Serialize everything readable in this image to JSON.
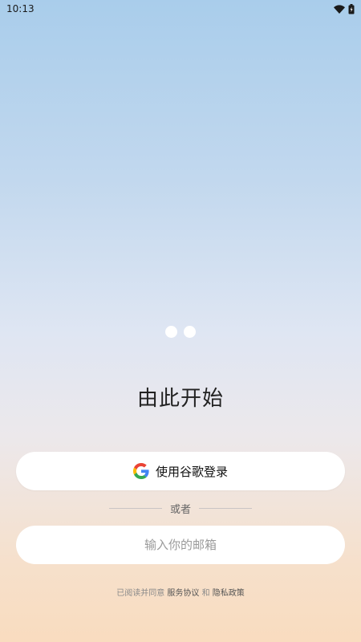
{
  "status_bar": {
    "time": "10:13"
  },
  "main": {
    "title": "由此开始",
    "google_button_label": "使用谷歌登录",
    "divider_text": "或者",
    "email_placeholder": "输入你的邮箱",
    "terms": {
      "prefix": "已阅读并同意 ",
      "service_link": "服务协议",
      "and": " 和 ",
      "privacy_link": "隐私政策"
    }
  },
  "icons": {
    "wifi": "wifi-icon",
    "battery": "battery-icon",
    "google": "google-icon"
  },
  "colors": {
    "google_blue": "#4285F4",
    "google_red": "#EA4335",
    "google_yellow": "#FBBC05",
    "google_green": "#34A853"
  }
}
